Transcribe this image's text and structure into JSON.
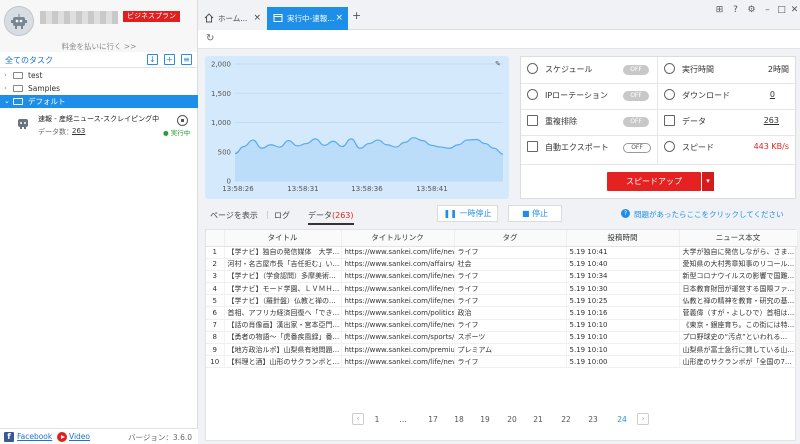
{
  "sidebar": {
    "plan_badge": "ビジネスプラン",
    "pay_link": "料金を払いに行く >>",
    "all_tasks": "全てのタスク",
    "folders": [
      "test",
      "Samples",
      "デフォルト"
    ],
    "task": {
      "title": "速報 - 産経ニュース-スクレイピング中",
      "count_label": "データ数：",
      "count": "263",
      "status": "● 実行中"
    },
    "footer": {
      "facebook": "Facebook",
      "video": "Video",
      "version": "バージョン：3.6.0"
    }
  },
  "tabs": {
    "home": "ホーム...",
    "running": "実行中-速報..."
  },
  "chart_data": {
    "type": "area",
    "x": [
      "13:58:26",
      "13:58:31",
      "13:58:36",
      "13:58:41"
    ],
    "yticks": [
      0,
      500,
      1000,
      1500,
      2000
    ],
    "ylim": [
      0,
      2000
    ],
    "series": [
      {
        "values": [
          470,
          590,
          700,
          560,
          620,
          580,
          690,
          600,
          640,
          720,
          610,
          680,
          590,
          720,
          560,
          640,
          700,
          620,
          580,
          660,
          740,
          690,
          610,
          580,
          560,
          620,
          700,
          710,
          640,
          560,
          460
        ]
      }
    ],
    "colors": {
      "fill": "#b8dcfa",
      "line": "#5aaaf0",
      "background": "#d4eafc"
    }
  },
  "stats": {
    "schedule": {
      "label": "スケジュール",
      "toggle": "OFF"
    },
    "ip_rotation": {
      "label": "IPローテーション",
      "toggle": "OFF"
    },
    "dedupe": {
      "label": "重複排除",
      "toggle": "OFF"
    },
    "auto_export": {
      "label": "自動エクスポート",
      "toggle": "OFF"
    },
    "run_time": {
      "label": "実行時間",
      "value": "2時間"
    },
    "download": {
      "label": "ダウンロード",
      "value": "0"
    },
    "data": {
      "label": "データ",
      "value": "263"
    },
    "speed": {
      "label": "スピード",
      "value": "443 KB/s",
      "color": "#e52222"
    },
    "speedup_button": "スピードアップ"
  },
  "data_tabs": {
    "view_page": "ページを表示",
    "log": "ログ",
    "data": "データ",
    "data_count": "(263)",
    "pause": "一時停止",
    "stop": "停止",
    "help": "問題があったらここをクリックしてください"
  },
  "table": {
    "columns": [
      "",
      "タイトル",
      "タイトルリンク",
      "タグ",
      "投稿時間",
      "ニュース本文"
    ],
    "rows": [
      [
        "1",
        "【学ナビ】独自の発信媒体　大学...",
        "https://www.sankei.com/life/news/...",
        "ライフ",
        "5.19 10:41",
        "大学が独自に発信しながら、さま..."
      ],
      [
        "2",
        "河村・名古屋市長「吉任拒む」い...",
        "https://www.sankei.com/affairs/ne...",
        "社会",
        "5.19 10:40",
        "愛知県の大村秀章知事のリコール..."
      ],
      [
        "3",
        "【学ナビ】（学食認問）多摩美術...",
        "https://www.sankei.com/life/news/...",
        "ライフ",
        "5.19 10:34",
        "新型コロナウイルスの影響で国難..."
      ],
      [
        "4",
        "【学ナビ】モード学園、ＬＶＭＨ...",
        "https://www.sankei.com/life/news/...",
        "ライフ",
        "5.19 10:30",
        "日本教育財団が運営する国際ファ..."
      ],
      [
        "5",
        "【学ナビ】（羅針盤）仏教と禅の...",
        "https://www.sankei.com/life/news/...",
        "ライフ",
        "5.19 10:25",
        "仏教と禅の精神を教育・研究の基..."
      ],
      [
        "6",
        "首相、アフリカ経済回復へ「でき...",
        "https://www.sankei.com/politics/ne...",
        "政治",
        "5.19 10:16",
        "菅義偉（すが・よしひで）首相は..."
      ],
      [
        "7",
        "【話の肖像画】漢出家・宮本亞門...",
        "https://www.sankei.com/life/news/...",
        "ライフ",
        "5.19 10:10",
        "《東京・銀座育ち。この街には特..."
      ],
      [
        "8",
        "【勇者の物語～「虎番疾風録」番...",
        "https://www.sankei.com/sports/ne...",
        "スポーツ",
        "5.19 10:10",
        "プロ野球史の“汚点”といわれる..."
      ],
      [
        "9",
        "【地方政治ルポ】山梨県有地問題...",
        "https://www.sankei.com/premium/...",
        "プレミアム",
        "5.19 10:10",
        "山梨県が富士急行に貸している山..."
      ],
      [
        "10",
        "【料理と酒】山形のサクランボと...",
        "https://www.sankei.com/life/news/...",
        "ライフ",
        "5.19 10:00",
        "山形産のサクランボが「全国の7..."
      ]
    ]
  },
  "pagination": {
    "pages": [
      "1",
      "...",
      "17",
      "18",
      "19",
      "20",
      "21",
      "22",
      "23",
      "24"
    ],
    "current": "24"
  }
}
